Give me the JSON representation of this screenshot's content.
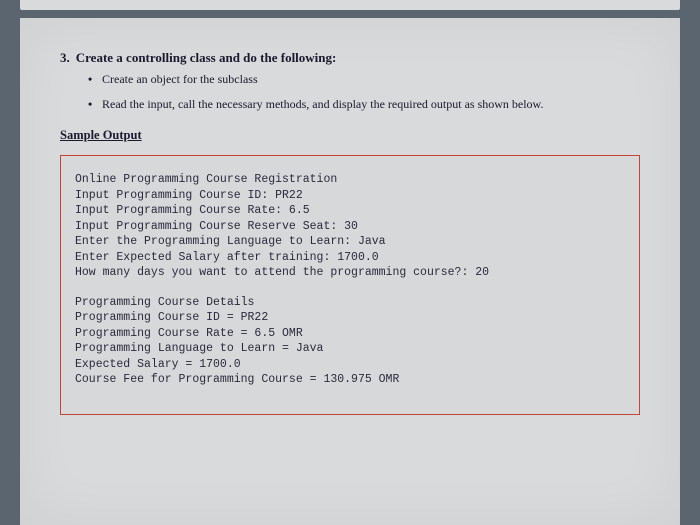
{
  "question": {
    "number": "3.",
    "text": "Create a controlling class and do the following:",
    "bullets": [
      "Create an object for the subclass",
      "Read the input, call the necessary methods, and display the required output as shown below."
    ]
  },
  "sampleOutputHeading": "Sample Output",
  "output": {
    "block1": [
      "Online Programming Course Registration",
      "Input Programming Course ID: PR22",
      "Input Programming Course Rate: 6.5",
      "Input Programming Course Reserve Seat: 30",
      "Enter the Programming Language to Learn: Java",
      "Enter Expected Salary after training: 1700.0",
      "How many days you want to attend the programming course?: 20"
    ],
    "block2": [
      "Programming Course Details",
      "Programming Course ID = PR22",
      "Programming Course Rate = 6.5 OMR",
      "Programming Language to Learn = Java",
      "Expected Salary = 1700.0",
      "Course Fee for Programming Course = 130.975 OMR"
    ]
  }
}
